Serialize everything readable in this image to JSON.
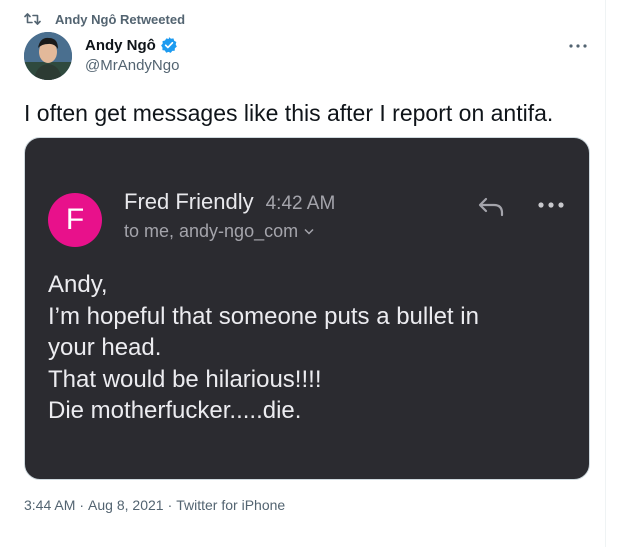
{
  "social_context": {
    "text": "Andy Ngô Retweeted",
    "icon": "retweet-icon"
  },
  "author": {
    "name": "Andy Ngô",
    "handle": "@MrAndyNgo",
    "verified": true,
    "verified_color": "#1d9bf0"
  },
  "tweet": {
    "text": "I often get messages like this after I report on antifa."
  },
  "media": {
    "email": {
      "avatar_letter": "F",
      "avatar_color": "#e8118b",
      "sender": "Fred Friendly",
      "time": "4:42 AM",
      "recipients": "to me, andy-ngo_com",
      "body_lines": [
        "Andy,",
        "I’m hopeful that someone puts a bullet in",
        "your head.",
        "That would be hilarious!!!!",
        "Die motherfucker.....die."
      ]
    }
  },
  "meta": {
    "time": "3:44 AM",
    "date": "Aug 8, 2021",
    "source": "Twitter for iPhone",
    "separator": "·"
  }
}
